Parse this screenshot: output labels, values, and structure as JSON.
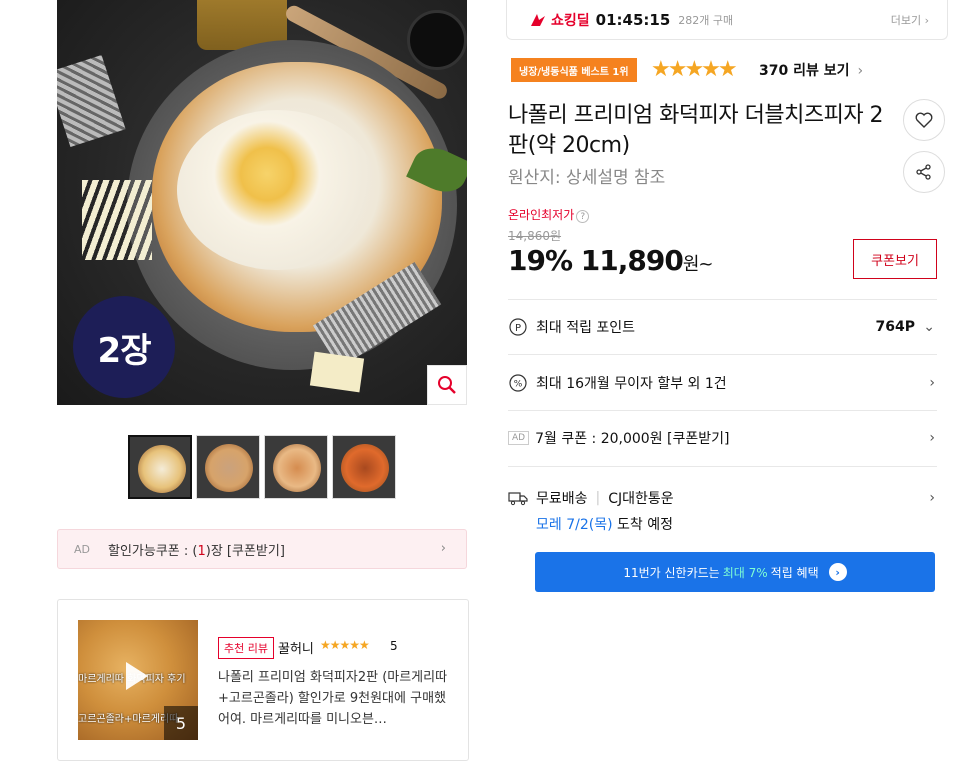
{
  "gallery": {
    "badge_text": "2장",
    "thumbs": [
      {
        "name": "thumb-1",
        "colors": [
          "#e7c27a",
          "#f4ecd8"
        ]
      },
      {
        "name": "thumb-2",
        "colors": [
          "#d7a36a",
          "#caa27d"
        ]
      },
      {
        "name": "thumb-3",
        "colors": [
          "#e9b985",
          "#d58c4f"
        ]
      },
      {
        "name": "thumb-4",
        "colors": [
          "#e06a2c",
          "#a8491f"
        ]
      }
    ]
  },
  "ad_coupon": {
    "ad_label": "AD",
    "text_prefix": "할인가능쿠폰 : (",
    "count": "1",
    "text_suffix": ")장 [쿠폰받기]"
  },
  "review": {
    "tag": "추천 리뷰",
    "user": "꿀허니",
    "stars": "★★★★★",
    "score": "5",
    "body": "나폴리 프리미엄 화덕피자2판 (마르게리따+고르곤졸라) 할인가로 9천원대에 구매했어여. 마르게리따를 미니오븐…",
    "thumb_overlay_1": "마르게리따 화덕피자 후기",
    "thumb_overlay_2": "고르곤졸라+마르게리따",
    "image_count": "5"
  },
  "deal": {
    "logo": "쇼킹딜",
    "timer": "01:45:15",
    "sold": "282개 구매",
    "more": "더보기"
  },
  "rating": {
    "badge": "냉장/냉동식품 베스트 1위",
    "stars": "★★★★★",
    "review_link": "370 리뷰 보기"
  },
  "product": {
    "title": "나폴리 프리미엄 화덕피자 더블치즈피자 2판(약 20cm)",
    "origin": "원산지: 상세설명 참조"
  },
  "price": {
    "lowest_label": "온라인최저가",
    "original": "14,860원",
    "discount": "19%",
    "sale": "11,890",
    "currency": "원~",
    "coupon_button": "쿠폰보기"
  },
  "benefits": {
    "points_label": "최대 적립 포인트",
    "points_value": "764P",
    "installment": "최대 16개월 무이자 할부 외 1건",
    "coupon_ad": "AD",
    "coupon_text": "7월 쿠폰 : 20,000원 [쿠폰받기]",
    "shipping": "무료배송",
    "carrier": "CJ대한통운",
    "delivery_date": "모레 7/2(목)",
    "delivery_suffix": "도착 예정"
  },
  "card_banner": {
    "prefix": "11번가 신한카드는",
    "highlight": "최대 7%",
    "suffix": "적립 혜택"
  }
}
